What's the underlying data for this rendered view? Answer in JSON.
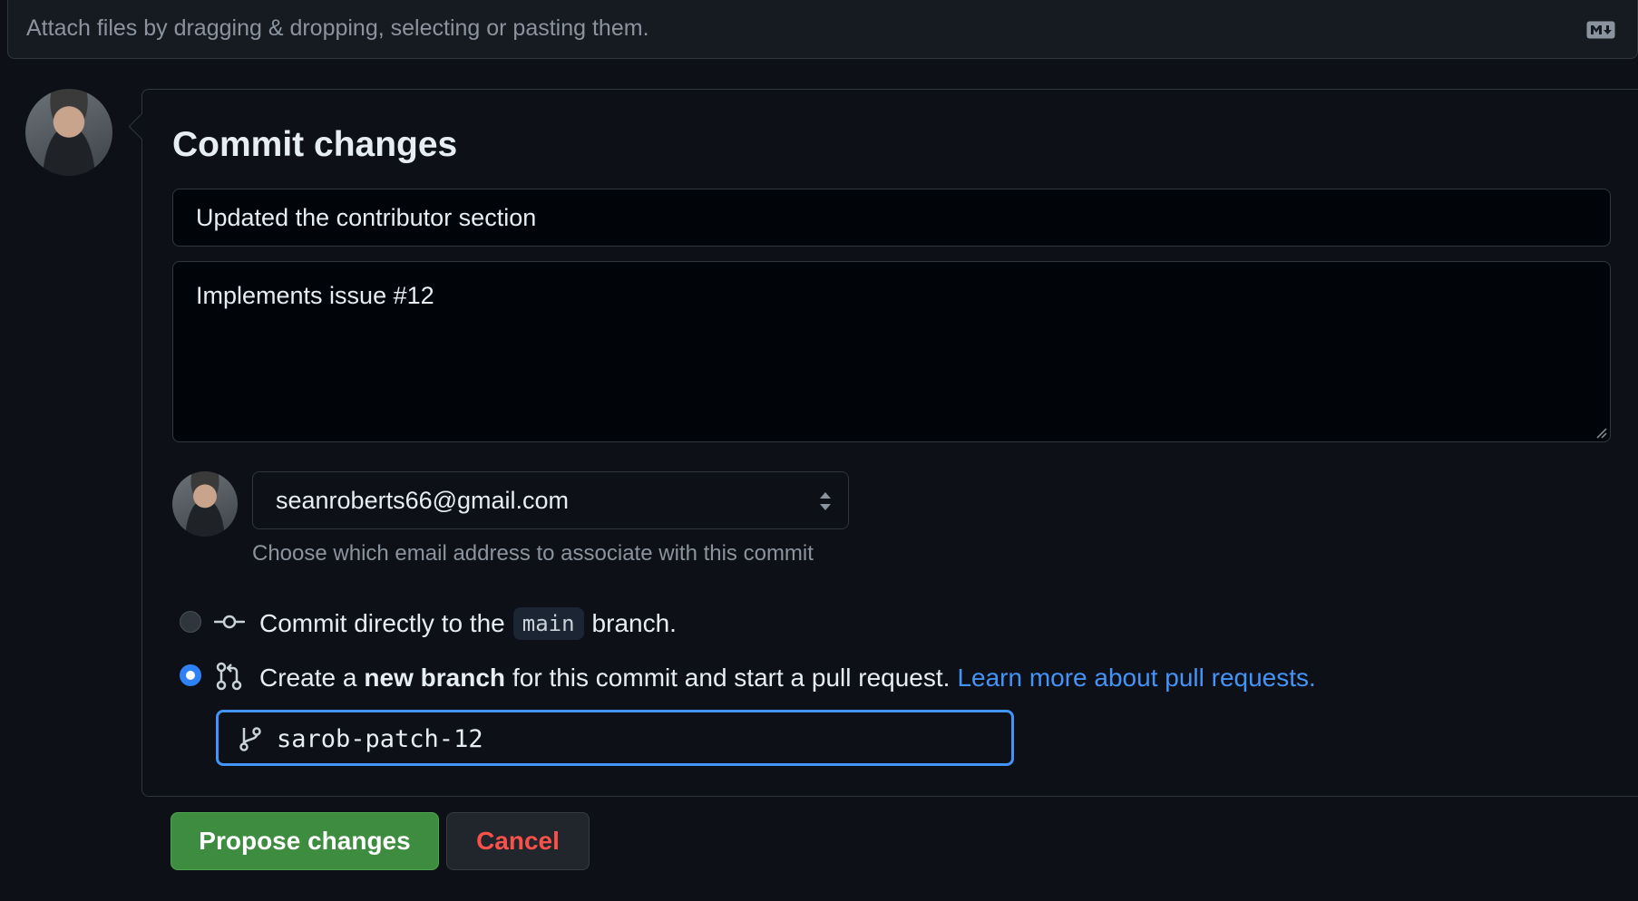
{
  "attach": {
    "text": "Attach files by dragging & dropping, selecting or pasting them.",
    "icon": "markdown-icon"
  },
  "commit": {
    "title": "Commit changes",
    "summary_value": "Updated the contributor section",
    "description_value": "Implements issue #12"
  },
  "email": {
    "selected": "seanroberts66@gmail.com",
    "hint": "Choose which email address to associate with this commit"
  },
  "options": {
    "direct": {
      "prefix": "Commit directly to the",
      "branch": "main",
      "suffix": "branch.",
      "selected": false
    },
    "new_branch": {
      "prefix": "Create a",
      "bold": "new branch",
      "suffix": "for this commit and start a pull request.",
      "link": "Learn more about pull requests.",
      "selected": true
    }
  },
  "branch_input": {
    "value": "sarob-patch-12"
  },
  "buttons": {
    "propose": "Propose changes",
    "cancel": "Cancel"
  },
  "colors": {
    "background": "#0d1117",
    "accent": "#4493f8",
    "primary_button": "#3d8c40",
    "danger": "#f85149"
  }
}
